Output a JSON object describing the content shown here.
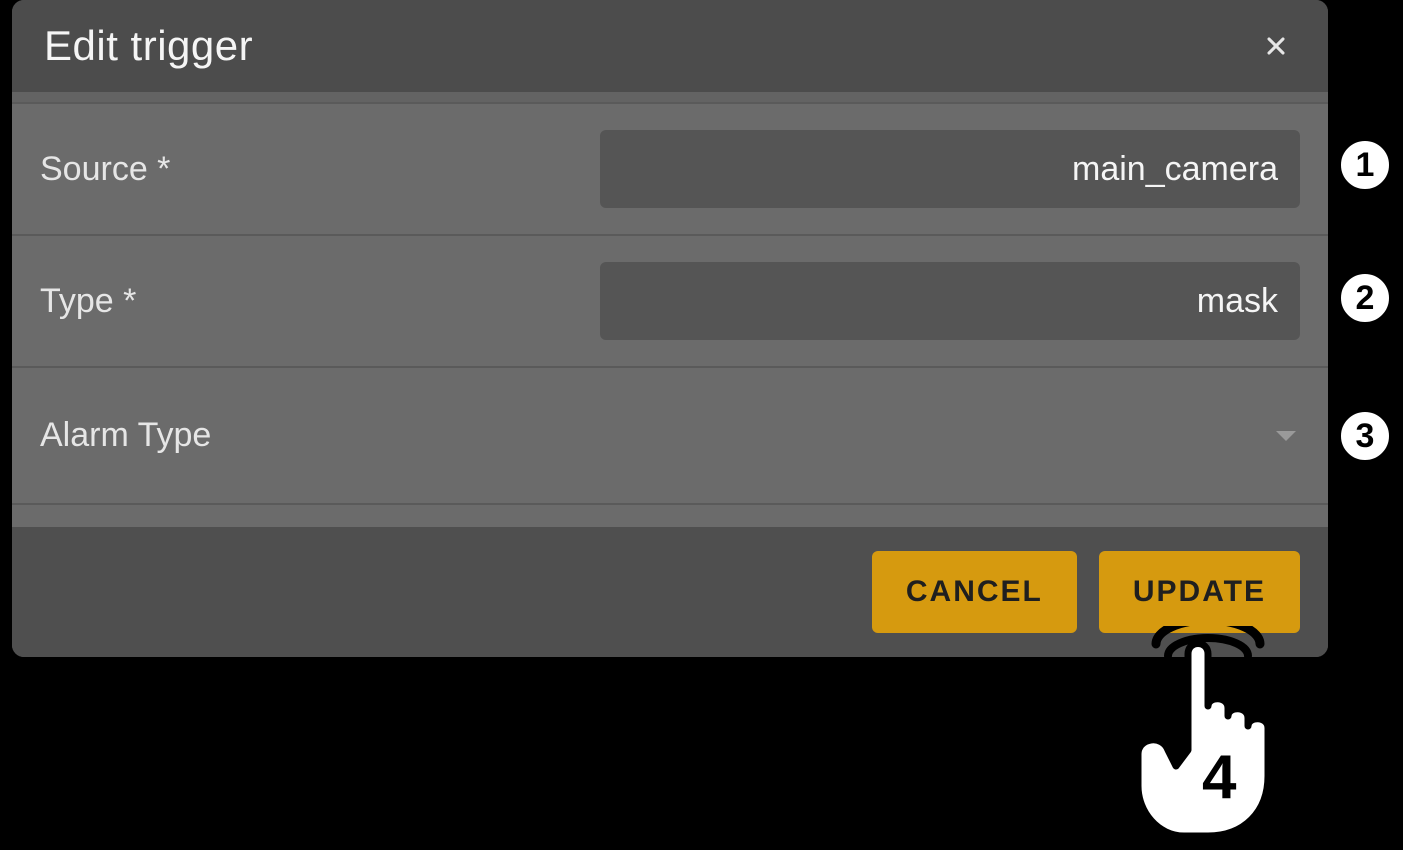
{
  "dialog": {
    "title": "Edit trigger",
    "fields": {
      "source": {
        "label": "Source *",
        "value": "main_camera"
      },
      "type": {
        "label": "Type *",
        "value": "mask"
      },
      "alarm": {
        "label": "Alarm Type",
        "value": ""
      }
    },
    "buttons": {
      "cancel": "CANCEL",
      "update": "UPDATE"
    }
  },
  "annotations": {
    "badge1": "1",
    "badge2": "2",
    "badge3": "3",
    "cursor_number": "4"
  }
}
